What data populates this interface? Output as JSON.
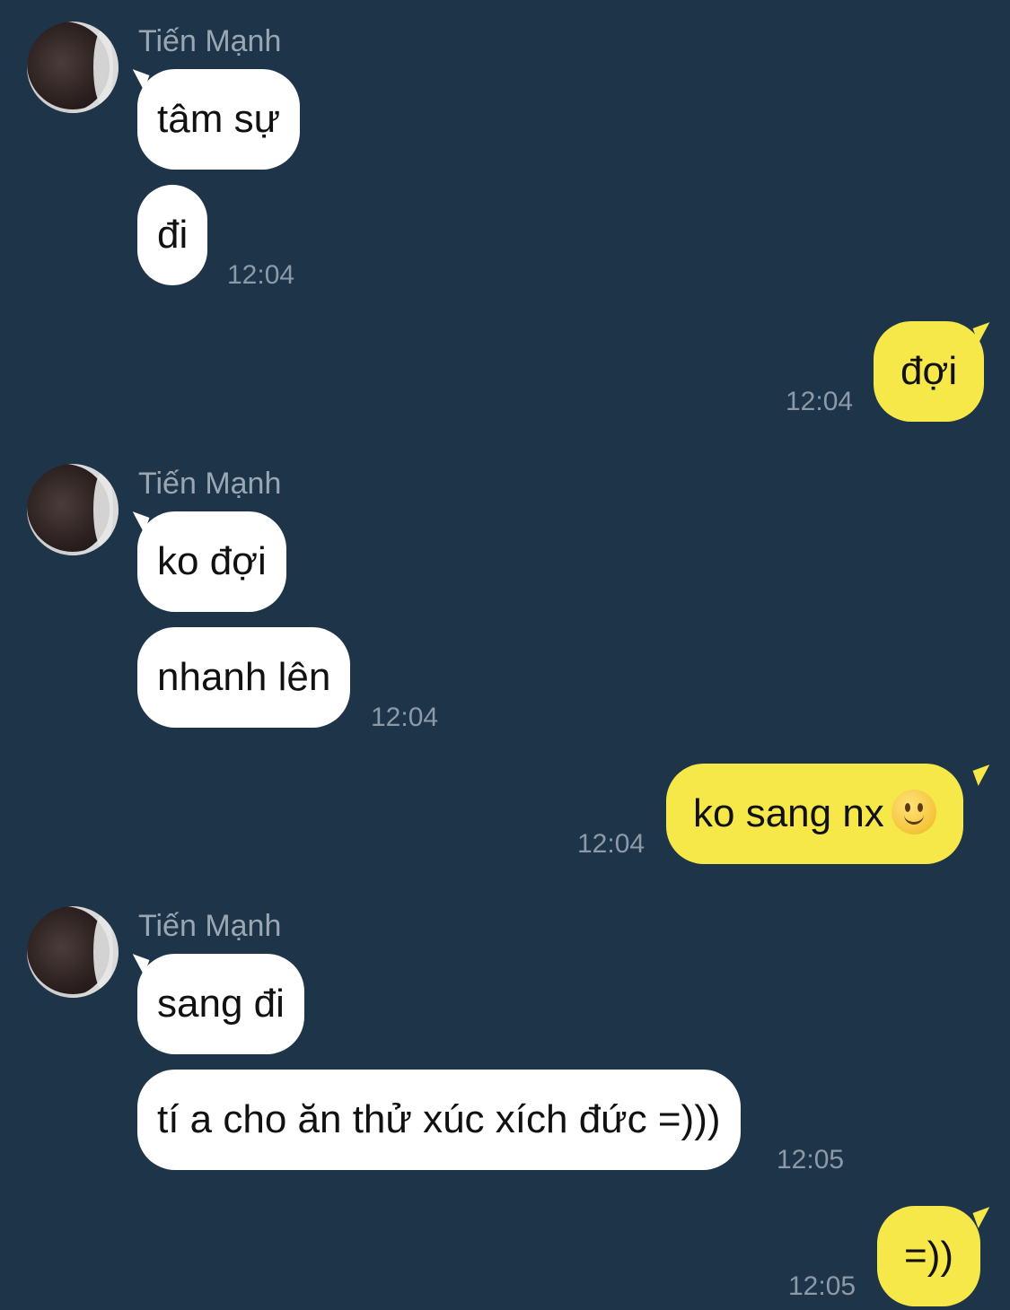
{
  "contact": {
    "name": "Tiến Mạnh"
  },
  "messages": [
    {
      "direction": "in",
      "text": "tâm sự"
    },
    {
      "direction": "in",
      "text": "đi",
      "time": "12:04"
    },
    {
      "direction": "out",
      "text": "đợi",
      "time": "12:04"
    },
    {
      "direction": "in",
      "text": "ko đợi"
    },
    {
      "direction": "in",
      "text": "nhanh lên",
      "time": "12:04"
    },
    {
      "direction": "out",
      "text": "ko sang nx",
      "emoji": "slightly-smiling-face-icon",
      "time": "12:04"
    },
    {
      "direction": "in",
      "text": "sang đi"
    },
    {
      "direction": "in",
      "text": "tí a cho ăn thử xúc xích đức =)))",
      "time": "12:05"
    },
    {
      "direction": "out",
      "text": "=))",
      "time": "12:05"
    }
  ],
  "colors": {
    "background": "#1e3449",
    "incoming_bubble": "#ffffff",
    "outgoing_bubble": "#f7e84a",
    "sender_name": "#9aa7b3",
    "timestamp": "#8c9aa7"
  }
}
